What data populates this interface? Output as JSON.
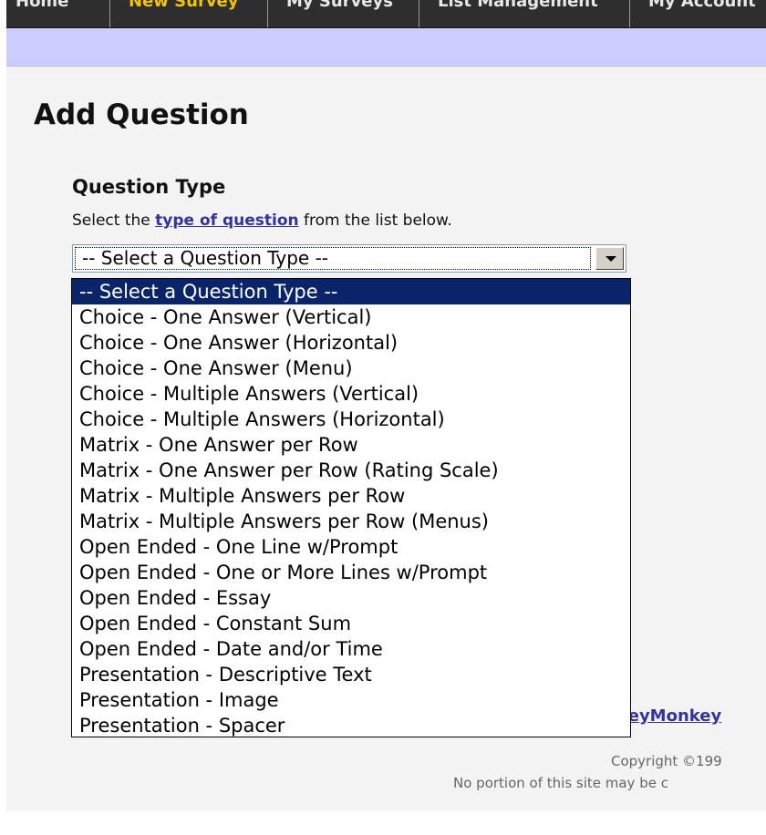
{
  "nav": {
    "items": [
      {
        "label": "Home",
        "active": false
      },
      {
        "label": "New Survey",
        "active": true
      },
      {
        "label": "My Surveys",
        "active": false
      },
      {
        "label": "List Management",
        "active": false
      },
      {
        "label": "My Account",
        "active": false
      }
    ]
  },
  "page": {
    "title": "Add Question"
  },
  "question_type": {
    "heading": "Question Type",
    "instruction_prefix": "Select the ",
    "instruction_link": "type of question",
    "instruction_suffix": " from the list below.",
    "selected_value": "-- Select a Question Type --",
    "options": [
      "-- Select a Question Type --",
      "Choice - One Answer (Vertical)",
      "Choice - One Answer (Horizontal)",
      "Choice - One Answer (Menu)",
      "Choice - Multiple Answers (Vertical)",
      "Choice - Multiple Answers (Horizontal)",
      "Matrix - One Answer per Row",
      "Matrix - One Answer per Row (Rating Scale)",
      "Matrix - Multiple Answers per Row",
      "Matrix - Multiple Answers per Row (Menus)",
      "Open Ended - One Line w/Prompt",
      "Open Ended - One or More Lines w/Prompt",
      "Open Ended - Essay",
      "Open Ended - Constant Sum",
      "Open Ended - Date and/or Time",
      "Presentation - Descriptive Text",
      "Presentation - Image",
      "Presentation - Spacer"
    ],
    "highlighted_index": 0
  },
  "footer": {
    "link_text": "veyMonkey",
    "copyright": "Copyright ©199",
    "disclaimer": "No portion of this site may be c"
  },
  "colors": {
    "nav_bg": "#2e2e2e",
    "nav_active": "#f5c400",
    "sub_bar": "#ccccff",
    "link": "#333399",
    "selection": "#0a246a"
  }
}
